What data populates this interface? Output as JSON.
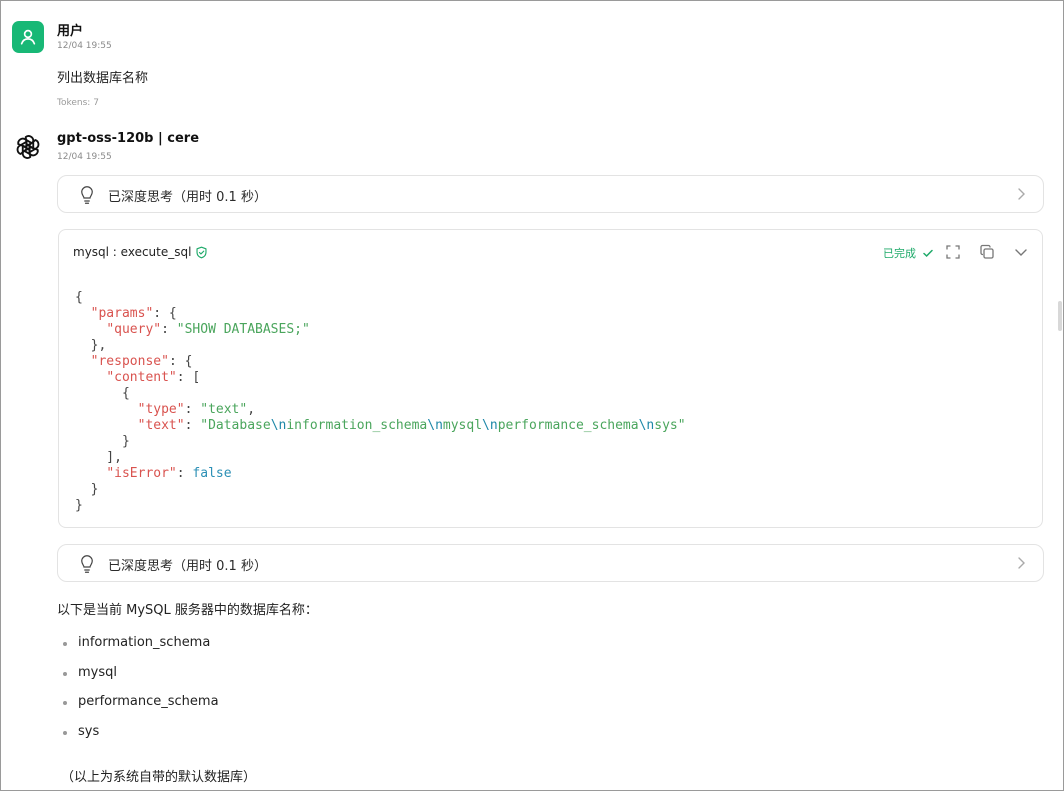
{
  "user_message": {
    "name": "用户",
    "time": "12/04 19:55",
    "text": "列出数据库名称",
    "tokens": "Tokens: 7"
  },
  "assistant_message": {
    "name": "gpt-oss-120b | cere",
    "time": "12/04 19:55",
    "thinking_1": "已深度思考（用时 0.1 秒）",
    "thinking_2": "已深度思考（用时 0.1 秒）",
    "tool_call": {
      "title": "mysql : execute_sql",
      "status": "已完成",
      "code_lines": [
        [
          [
            "p",
            "{"
          ]
        ],
        [
          [
            "p",
            "  "
          ],
          [
            "k",
            "\"params\""
          ],
          [
            "p",
            ": {"
          ]
        ],
        [
          [
            "p",
            "    "
          ],
          [
            "k",
            "\"query\""
          ],
          [
            "p",
            ": "
          ],
          [
            "s",
            "\"SHOW DATABASES;\""
          ]
        ],
        [
          [
            "p",
            "  },"
          ]
        ],
        [
          [
            "p",
            "  "
          ],
          [
            "k",
            "\"response\""
          ],
          [
            "p",
            ": {"
          ]
        ],
        [
          [
            "p",
            "    "
          ],
          [
            "k",
            "\"content\""
          ],
          [
            "p",
            ": ["
          ]
        ],
        [
          [
            "p",
            "      {"
          ]
        ],
        [
          [
            "p",
            "        "
          ],
          [
            "k",
            "\"type\""
          ],
          [
            "p",
            ": "
          ],
          [
            "s",
            "\"text\""
          ],
          [
            "p",
            ","
          ]
        ],
        [
          [
            "p",
            "        "
          ],
          [
            "k",
            "\"text\""
          ],
          [
            "p",
            ": "
          ],
          [
            "s",
            "\"Database"
          ],
          [
            "e",
            "\\n"
          ],
          [
            "s",
            "information_schema"
          ],
          [
            "e",
            "\\n"
          ],
          [
            "s",
            "mysql"
          ],
          [
            "e",
            "\\n"
          ],
          [
            "s",
            "performance_schema"
          ],
          [
            "e",
            "\\n"
          ],
          [
            "s",
            "sys\""
          ]
        ],
        [
          [
            "p",
            "      }"
          ]
        ],
        [
          [
            "p",
            "    ],"
          ]
        ],
        [
          [
            "p",
            "    "
          ],
          [
            "k",
            "\"isError\""
          ],
          [
            "p",
            ": "
          ],
          [
            "b",
            "false"
          ]
        ],
        [
          [
            "p",
            "  }"
          ]
        ],
        [
          [
            "p",
            "}"
          ]
        ]
      ]
    },
    "answer_intro": "以下是当前 MySQL 服务器中的数据库名称：",
    "databases": [
      "information_schema",
      "mysql",
      "performance_schema",
      "sys"
    ],
    "note": "（以上为系统自带的默认数据库）"
  },
  "icons": {
    "user_avatar": "user-icon",
    "assistant_avatar": "openai-logo-icon",
    "thinking": "lightbulb-icon",
    "expand": "chevron-right-icon",
    "verified": "shield-check-icon",
    "status": "check-icon",
    "fullscreen": "fullscreen-icon",
    "copy": "copy-icon",
    "collapse": "chevron-down-icon"
  },
  "colors": {
    "accent": "#18b876",
    "status": "#1faa6a",
    "json_key": "#d9534f",
    "json_string": "#4aa55c",
    "json_escape": "#1e88a8"
  }
}
